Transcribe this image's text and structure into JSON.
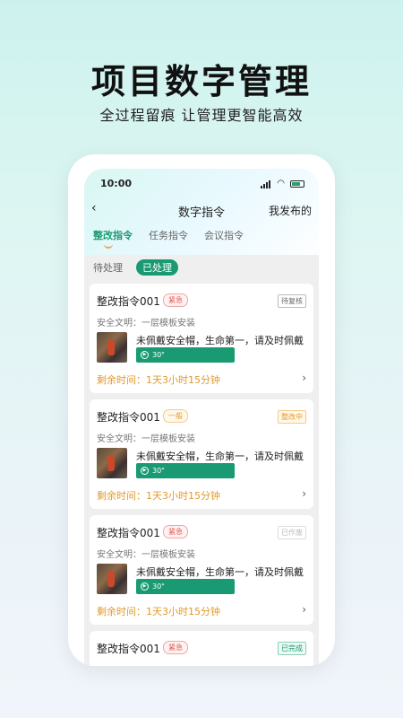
{
  "hero": {
    "title": "项目数字管理",
    "subtitle": "全过程留痕 让管理更智能高效"
  },
  "status_bar": {
    "time": "10:00"
  },
  "nav": {
    "back_icon": "chevron-left-icon",
    "title": "数字指令",
    "right": "我发布的"
  },
  "tabs": [
    {
      "label": "整改指令",
      "active": true
    },
    {
      "label": "任务指令",
      "active": false
    },
    {
      "label": "会议指令",
      "active": false
    }
  ],
  "filter": {
    "pending": "待处理",
    "done": "已处理"
  },
  "cards": [
    {
      "title": "整改指令001",
      "priority": "紧急",
      "status": "待复核",
      "subtitle": "安全文明：一层模板安装",
      "desc": "未佩戴安全帽，生命第一，请及时佩戴",
      "bar_label": "30\"",
      "time": "剩余时间：1天3小时15分钟"
    },
    {
      "title": "整改指令001",
      "priority": "一般",
      "status": "整改中",
      "subtitle": "安全文明：一层模板安装",
      "desc": "未佩戴安全帽，生命第一，请及时佩戴",
      "bar_label": "30\"",
      "time": "剩余时间：1天3小时15分钟"
    },
    {
      "title": "整改指令001",
      "priority": "紧急",
      "status": "已作废",
      "subtitle": "安全文明：一层模板安装",
      "desc": "未佩戴安全帽，生命第一，请及时佩戴",
      "bar_label": "30\"",
      "time": "剩余时间：1天3小时15分钟"
    },
    {
      "title": "整改指令001",
      "priority": "紧急",
      "status": "已完成"
    }
  ],
  "colors": {
    "accent": "#1a9a72",
    "urgent": "#e0534c",
    "warning": "#e39a2a"
  }
}
